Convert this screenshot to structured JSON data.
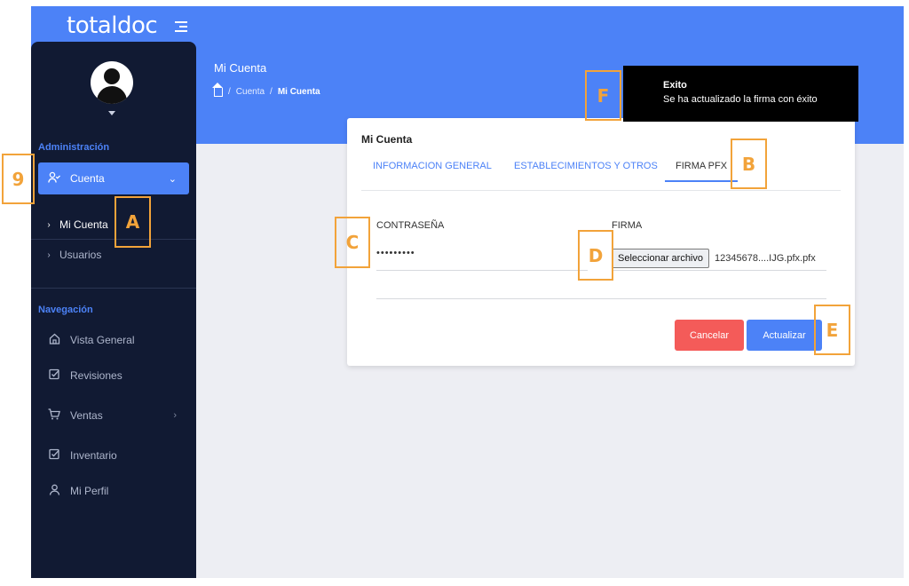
{
  "brand": {
    "name": "totaldoc"
  },
  "header": {
    "title": "Mi Cuenta",
    "breadcrumb": {
      "home_icon": "home-icon",
      "items": [
        "Cuenta",
        "Mi Cuenta"
      ],
      "separator": "/"
    }
  },
  "sidebar": {
    "sections": [
      {
        "title": "Administración",
        "items": [
          {
            "label": "Cuenta",
            "icon": "user-check-icon",
            "active": true,
            "expanded": true,
            "children": [
              "Mi Cuenta",
              "Usuarios"
            ]
          }
        ]
      },
      {
        "title": "Navegación",
        "items": [
          {
            "label": "Vista General",
            "icon": "home-icon"
          },
          {
            "label": "Revisiones",
            "icon": "check-square-icon"
          },
          {
            "label": "Ventas",
            "icon": "cart-icon",
            "has_children": true
          },
          {
            "label": "Inventario",
            "icon": "check-square-icon"
          },
          {
            "label": "Mi Perfil",
            "icon": "user-icon"
          }
        ]
      }
    ]
  },
  "card": {
    "title": "Mi Cuenta",
    "tabs": [
      "INFORMACION GENERAL",
      "ESTABLECIMIENTOS Y OTROS",
      "FIRMA PFX"
    ],
    "active_tab": "FIRMA PFX",
    "password_label": "CONTRASEÑA",
    "password_value": "•••••••••",
    "firma_label": "FIRMA",
    "file_button": "Seleccionar archivo",
    "file_name": "12345678....IJG.pfx.pfx",
    "cancel_label": "Cancelar",
    "update_label": "Actualizar"
  },
  "toast": {
    "title": "Exito",
    "message": "Se ha actualizado la firma con éxito"
  },
  "markers": [
    "9",
    "A",
    "B",
    "C",
    "D",
    "E",
    "F"
  ],
  "colors": {
    "primary": "#4c82f7",
    "sidebar": "#111a33",
    "danger": "#f45b59",
    "marker": "#f2a33a",
    "background": "#edeef3"
  }
}
